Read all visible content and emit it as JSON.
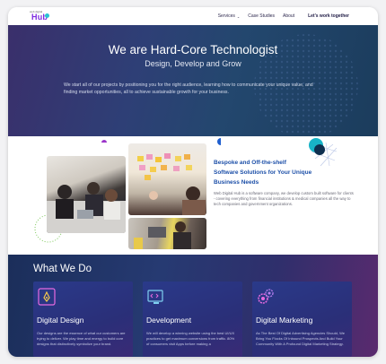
{
  "nav": {
    "logo_small": "web digital",
    "logo_big": "Hub",
    "items": [
      {
        "label": "Services",
        "caret": "⌄"
      },
      {
        "label": "Case Studies"
      },
      {
        "label": "About"
      }
    ],
    "cta": "Let's work together"
  },
  "hero": {
    "title": "We are Hard-Core Technologist",
    "subtitle": "Design, Develop and Grow",
    "body": "We start all of our projects by positioning you for the right audience, learning how to communicate your unique value, and finding market opportunities, all to achieve sustainable growth for your business."
  },
  "about": {
    "heading": "Bespoke and Off-the-shelf Software Solutions for Your Unique Business Needs",
    "body": "Web Digital Hub is a software company, we develop custom built software for clients - covering everything from financial institutions & medical companies all the way to tech companies and government organizations."
  },
  "services": {
    "heading": "What We Do",
    "cards": [
      {
        "icon": "design-tablet-icon",
        "title": "Digital Design",
        "body": "Our designs are the essence of what our customers are trying to deliver. We play time and energy to build core designs that distinctively symbolize your brand."
      },
      {
        "icon": "development-monitor-icon",
        "title": "Development",
        "body": "We will develop a winning website using the best UI/UX practices to get maximum conversions from traffic. 80% of consumers visit Apps before making a"
      },
      {
        "icon": "marketing-gears-icon",
        "title": "Digital Marketing",
        "body": "As The Best Of Digital Advertising Agencies Should, We Bring You Flocks Of Inbound Prospects And Build Your Community With A Profound Digital Marketing Strategy."
      }
    ]
  },
  "colors": {
    "brand": "#7d2be0",
    "accent_teal": "#18b3c7",
    "heading_blue": "#1c4fa8"
  }
}
